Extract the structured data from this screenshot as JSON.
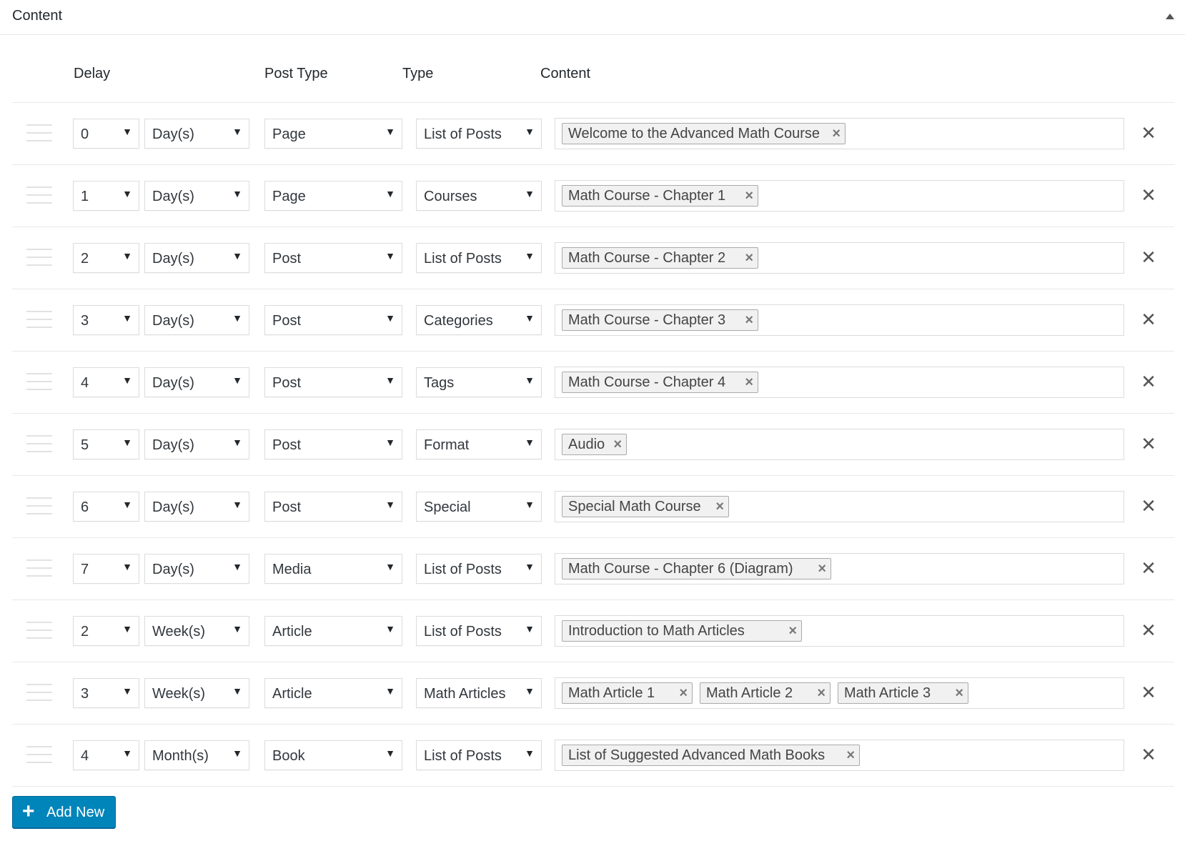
{
  "panel": {
    "title": "Content"
  },
  "columns": {
    "delay": "Delay",
    "post_type": "Post Type",
    "type": "Type",
    "content": "Content"
  },
  "icons": {
    "remove": "close-icon",
    "drag": "drag-handle-icon",
    "collapse": "caret-up-icon",
    "add": "plus-icon"
  },
  "colors": {
    "primary_button": "#0085ba",
    "border": "#dcdcdc",
    "tag_bg": "#f1f1f1"
  },
  "rows": [
    {
      "delay": "0",
      "unit": "Day(s)",
      "post_type": "Page",
      "type": "List of Posts",
      "tags": [
        "Welcome to the Advanced Math Course"
      ]
    },
    {
      "delay": "1",
      "unit": "Day(s)",
      "post_type": "Page",
      "type": "Courses",
      "tags": [
        "Math Course - Chapter 1"
      ]
    },
    {
      "delay": "2",
      "unit": "Day(s)",
      "post_type": "Post",
      "type": "List of Posts",
      "tags": [
        "Math Course - Chapter 2"
      ]
    },
    {
      "delay": "3",
      "unit": "Day(s)",
      "post_type": "Post",
      "type": "Categories",
      "tags": [
        "Math Course - Chapter 3"
      ]
    },
    {
      "delay": "4",
      "unit": "Day(s)",
      "post_type": "Post",
      "type": "Tags",
      "tags": [
        "Math Course - Chapter 4"
      ]
    },
    {
      "delay": "5",
      "unit": "Day(s)",
      "post_type": "Post",
      "type": "Format",
      "tags": [
        "Audio"
      ]
    },
    {
      "delay": "6",
      "unit": "Day(s)",
      "post_type": "Post",
      "type": "Special",
      "tags": [
        "Special Math Course"
      ]
    },
    {
      "delay": "7",
      "unit": "Day(s)",
      "post_type": "Media",
      "type": "List of Posts",
      "tags": [
        "Math Course - Chapter 6 (Diagram)"
      ]
    },
    {
      "delay": "2",
      "unit": "Week(s)",
      "post_type": "Article",
      "type": "List of Posts",
      "tags": [
        "Introduction to Math Articles"
      ]
    },
    {
      "delay": "3",
      "unit": "Week(s)",
      "post_type": "Article",
      "type": "Math Articles",
      "tags": [
        "Math Article 1",
        "Math Article 2",
        "Math Article 3"
      ]
    },
    {
      "delay": "4",
      "unit": "Month(s)",
      "post_type": "Book",
      "type": "List of Posts",
      "tags": [
        "List of Suggested Advanced Math Books"
      ]
    }
  ],
  "add_button": {
    "label": "Add New"
  }
}
